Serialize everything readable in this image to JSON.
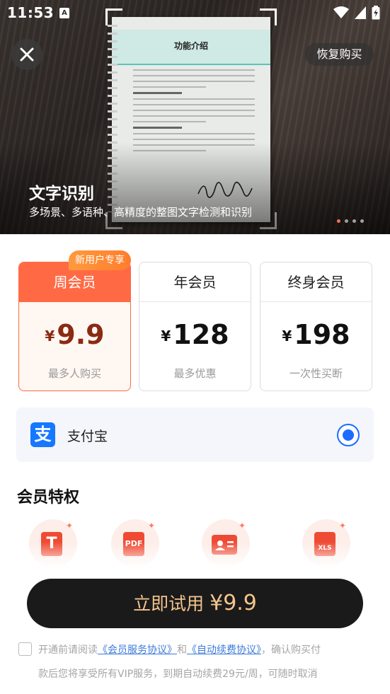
{
  "status_bar": {
    "time": "11:53",
    "notification_icon": "A"
  },
  "header": {
    "close_icon": "close-icon",
    "restore_label": "恢复购买"
  },
  "hero": {
    "title": "文字识别",
    "subtitle": "多场景、多语种、高精度的整图文字检测和识别",
    "sample_doc_title": "功能介绍",
    "carousel_count": 4,
    "carousel_active": 1
  },
  "plans": {
    "badge": "新用户专享",
    "items": [
      {
        "name": "周会员",
        "currency": "¥",
        "price": "9.9",
        "note": "最多人购买",
        "selected": true
      },
      {
        "name": "年会员",
        "currency": "¥",
        "price": "128",
        "note": "最多优惠",
        "selected": false
      },
      {
        "name": "终身会员",
        "currency": "¥",
        "price": "198",
        "note": "一次性买断",
        "selected": false
      }
    ]
  },
  "payment": {
    "method_label": "支付宝",
    "icon_glyph": "支",
    "selected": true
  },
  "privileges": {
    "title": "会员特权",
    "icons": [
      {
        "name": "text-recognition-icon",
        "glyph": "T"
      },
      {
        "name": "pdf-icon",
        "glyph": "PDF"
      },
      {
        "name": "id-card-icon",
        "glyph": ""
      },
      {
        "name": "xls-icon",
        "glyph": "XLS"
      }
    ]
  },
  "cta": {
    "label": "立即试用",
    "currency": "¥",
    "price": "9.9"
  },
  "agreement": {
    "prefix": "开通前请阅读",
    "link1": "《会员服务协议》",
    "conj": "和",
    "link2": "《自动续费协议》",
    "suffix": "，确认购买付",
    "line2": "款后您将享受所有VIP服务，到期自动续费29元/周，可随时取消"
  },
  "colors": {
    "accent": "#ff6a45",
    "badge": "#ff8c35",
    "cta_bg": "#1a1a1a",
    "cta_text": "#f3c48d",
    "radio": "#1a6dff",
    "link": "#3d7bd9"
  }
}
